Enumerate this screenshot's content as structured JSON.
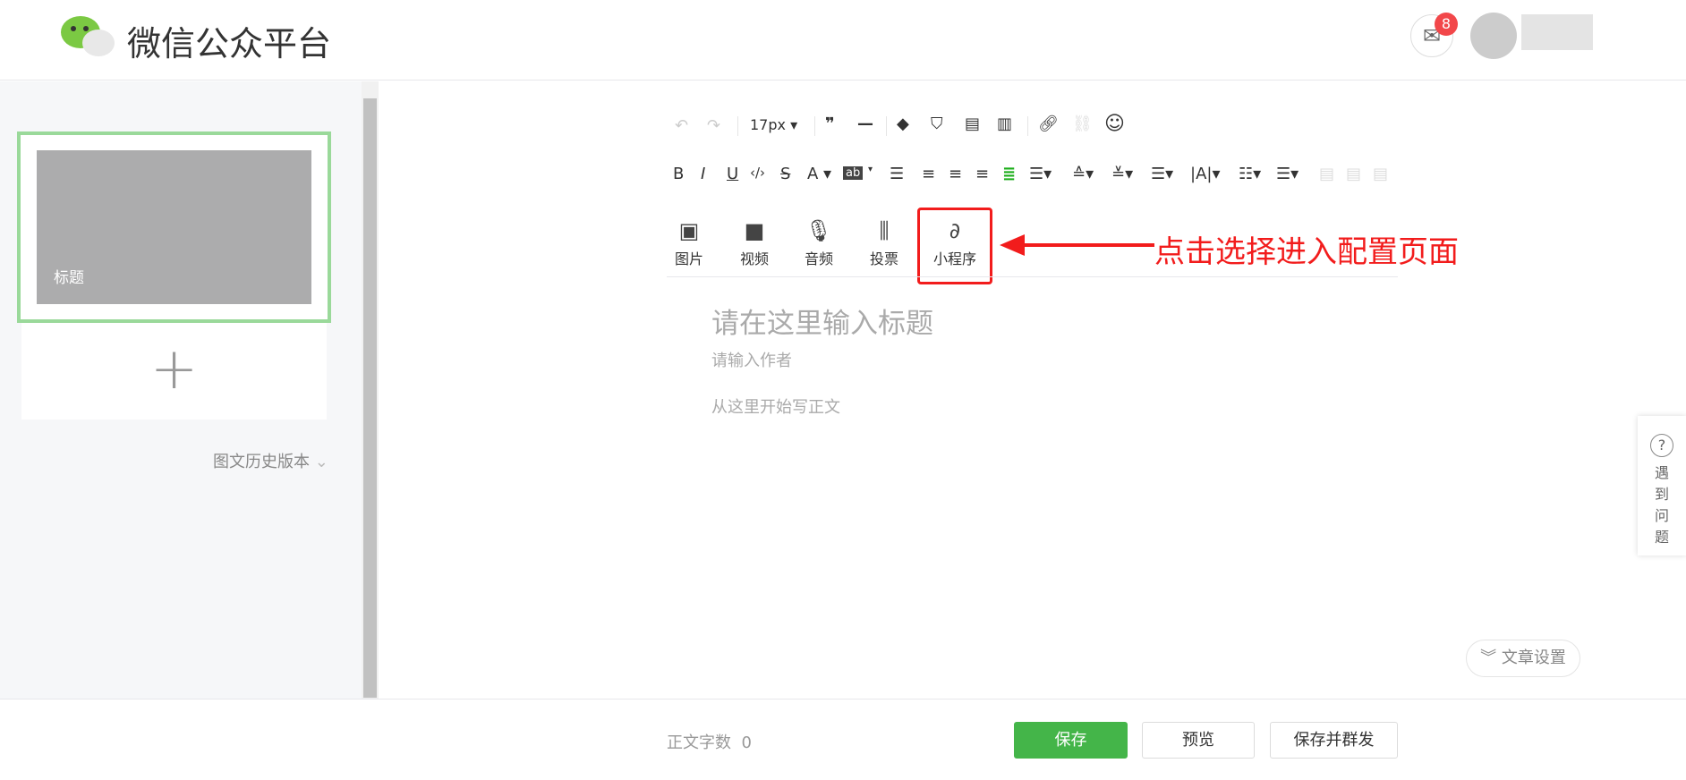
{
  "header": {
    "title": "微信公众平台",
    "mail_badge": "8"
  },
  "sidebar": {
    "card_title": "标题",
    "add": "+",
    "history": "图文历史版本"
  },
  "toolbar": {
    "font_size": "17px"
  },
  "insert": [
    {
      "icon": "image-icon",
      "glyph": "▣",
      "label": "图片"
    },
    {
      "icon": "video-icon",
      "glyph": "■",
      "label": "视频"
    },
    {
      "icon": "audio-icon",
      "glyph": "🎙",
      "label": "音频"
    },
    {
      "icon": "vote-icon",
      "glyph": "⫼",
      "label": "投票"
    },
    {
      "icon": "miniprogram-icon",
      "glyph": "∂",
      "label": "小程序"
    }
  ],
  "annotation": "点击选择进入配置页面",
  "editor": {
    "title_placeholder": "请在这里输入标题",
    "author_placeholder": "请输入作者",
    "body_placeholder": "从这里开始写正文"
  },
  "help": {
    "label": [
      "遇",
      "到",
      "问",
      "题"
    ]
  },
  "settings": "文章设置",
  "footer": {
    "word_count_label": "正文字数",
    "word_count": "0",
    "save": "保存",
    "preview": "预览",
    "save_publish": "保存并群发"
  }
}
